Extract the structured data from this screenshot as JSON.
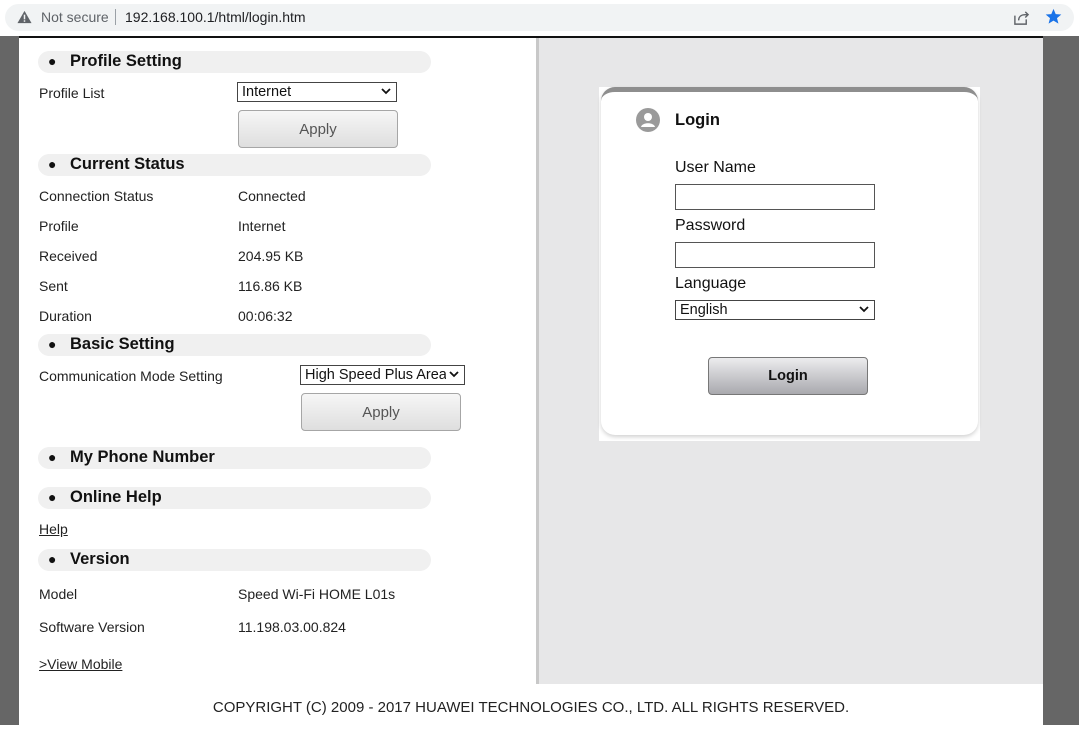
{
  "browser": {
    "security_label": "Not secure",
    "url": "192.168.100.1/html/login.htm"
  },
  "profile_setting": {
    "title": "Profile Setting",
    "profile_list_label": "Profile List",
    "profile_list_value": "Internet",
    "apply_label": "Apply"
  },
  "current_status": {
    "title": "Current Status",
    "rows": [
      {
        "label": "Connection Status",
        "value": "Connected"
      },
      {
        "label": "Profile",
        "value": "Internet"
      },
      {
        "label": "Received",
        "value": "204.95 KB"
      },
      {
        "label": "Sent",
        "value": "116.86 KB"
      },
      {
        "label": "Duration",
        "value": "00:06:32"
      }
    ]
  },
  "basic_setting": {
    "title": "Basic Setting",
    "mode_label": "Communication Mode Setting",
    "mode_value": "High Speed Plus Area",
    "apply_label": "Apply"
  },
  "my_phone_number": {
    "title": "My Phone Number"
  },
  "online_help": {
    "title": "Online Help",
    "help_link": "Help"
  },
  "version": {
    "title": "Version",
    "rows": [
      {
        "label": "Model",
        "value": "Speed Wi-Fi HOME L01s"
      },
      {
        "label": "Software Version",
        "value": "11.198.03.00.824"
      }
    ],
    "view_mobile_link": ">View Mobile"
  },
  "login": {
    "title": "Login",
    "username_label": "User Name",
    "username_value": "",
    "password_label": "Password",
    "password_value": "",
    "language_label": "Language",
    "language_value": "English",
    "login_button": "Login"
  },
  "footer": {
    "copyright": "COPYRIGHT (C) 2009 - 2017 HUAWEI TECHNOLOGIES CO., LTD. ALL RIGHTS RESERVED."
  },
  "icons": {
    "security": "warning-icon",
    "share": "share-icon",
    "bookmark": "star-icon",
    "user": "user-icon",
    "dropdown": "chevron-down-icon"
  },
  "colors": {
    "bookmark_star": "#1a73e8",
    "frame_gray": "#666666",
    "right_panel_bg": "#e7e7e8"
  }
}
